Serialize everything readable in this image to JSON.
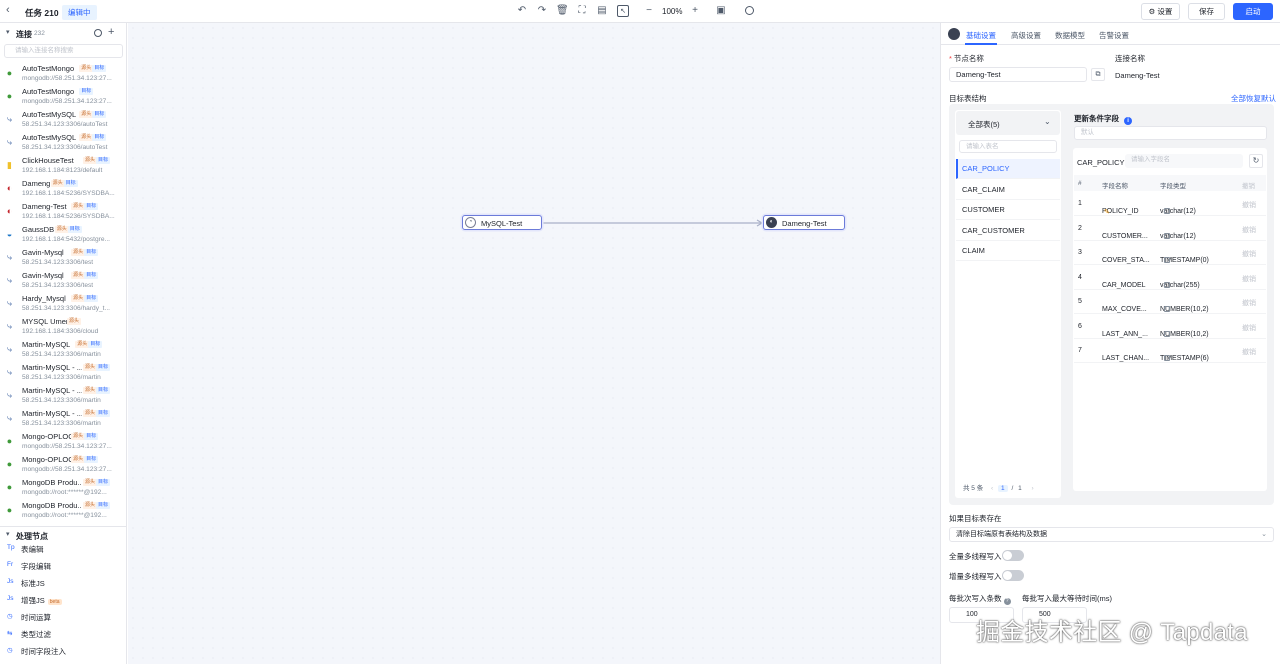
{
  "topbar": {
    "back_icon": "chevron-left-icon",
    "title": "任务 210",
    "status_badge": "编辑中",
    "zoom": "100%",
    "settings_label": "⚙ 设置",
    "save_label": "保存",
    "start_label": "启动",
    "accent": "#2c65ff"
  },
  "sidebar": {
    "connections_label": "连接",
    "connections_count": "232",
    "search_placeholder": "请输入连接名称搜索",
    "connections": [
      {
        "name": "AutoTestMongo",
        "addr": "mongodb://58.251.34.123:27...",
        "icon": "mongo",
        "src": "源头",
        "tgt": "目标"
      },
      {
        "name": "AutoTestMongo",
        "addr": "mongodb://58.251.34.123:27...",
        "icon": "mongo",
        "src": "",
        "tgt": "目标"
      },
      {
        "name": "AutoTestMySQL",
        "addr": "58.251.34.123:3306/autoTest",
        "icon": "mysql",
        "src": "源头",
        "tgt": "目标"
      },
      {
        "name": "AutoTestMySQL",
        "addr": "58.251.34.123:3306/autoTest",
        "icon": "mysql",
        "src": "源头",
        "tgt": "目标"
      },
      {
        "name": "ClickHouseTest",
        "addr": "192.168.1.184:8123/default",
        "icon": "clickhouse",
        "src": "源头",
        "tgt": "目标"
      },
      {
        "name": "Dameng",
        "addr": "192.168.1.184:5236/SYSDBA...",
        "icon": "dameng",
        "src": "源头",
        "tgt": "目标"
      },
      {
        "name": "Dameng-Test",
        "addr": "192.168.1.184:5236/SYSDBA...",
        "icon": "dameng",
        "src": "源头",
        "tgt": "目标"
      },
      {
        "name": "GaussDB",
        "addr": "192.168.1.184:5432/postgre...",
        "icon": "gauss",
        "src": "源头",
        "tgt": "目标"
      },
      {
        "name": "Gavin-Mysql",
        "addr": "58.251.34.123:3306/test",
        "icon": "mysql",
        "src": "源头",
        "tgt": "目标"
      },
      {
        "name": "Gavin-Mysql",
        "addr": "58.251.34.123:3306/test",
        "icon": "mysql",
        "src": "源头",
        "tgt": "目标"
      },
      {
        "name": "Hardy_Mysql",
        "addr": "58.251.34.123:3306/hardy_t...",
        "icon": "mysql",
        "src": "源头",
        "tgt": "目标"
      },
      {
        "name": "MYSQL Umer",
        "addr": "192.168.1.184:3306/cloud",
        "icon": "mysql",
        "src": "源头",
        "tgt": ""
      },
      {
        "name": "Martin-MySQL",
        "addr": "58.251.34.123:3306/martin",
        "icon": "mysql",
        "src": "源头",
        "tgt": "目标"
      },
      {
        "name": "Martin-MySQL - ...",
        "addr": "58.251.34.123:3306/martin",
        "icon": "mysql",
        "src": "源头",
        "tgt": "目标"
      },
      {
        "name": "Martin-MySQL - ...",
        "addr": "58.251.34.123:3306/martin",
        "icon": "mysql",
        "src": "源头",
        "tgt": "目标"
      },
      {
        "name": "Martin-MySQL - ...",
        "addr": "58.251.34.123:3306/martin",
        "icon": "mysql",
        "src": "源头",
        "tgt": "目标"
      },
      {
        "name": "Mongo-OPLOG",
        "addr": "mongodb://58.251.34.123:27...",
        "icon": "mongo",
        "src": "源头",
        "tgt": "目标"
      },
      {
        "name": "Mongo-OPLOG",
        "addr": "mongodb://58.251.34.123:27...",
        "icon": "mongo",
        "src": "源头",
        "tgt": "目标"
      },
      {
        "name": "MongoDB Produ...",
        "addr": "mongodb://root:******@192...",
        "icon": "mongo",
        "src": "源头",
        "tgt": "目标"
      },
      {
        "name": "MongoDB Produ...",
        "addr": "mongodb://root:******@192...",
        "icon": "mongo",
        "src": "源头",
        "tgt": "目标"
      }
    ],
    "processing_label": "处理节点",
    "processors": [
      {
        "icon": "Tp",
        "name": "表编辑",
        "beta": ""
      },
      {
        "icon": "Fr",
        "name": "字段编辑",
        "beta": ""
      },
      {
        "icon": "Js",
        "name": "标准JS",
        "beta": ""
      },
      {
        "icon": "Js",
        "name": "增强JS",
        "beta": "beta"
      },
      {
        "icon": "◷",
        "name": "时间运算",
        "beta": ""
      },
      {
        "icon": "⇆",
        "name": "类型过滤",
        "beta": ""
      },
      {
        "icon": "◷",
        "name": "时间字段注入",
        "beta": ""
      }
    ]
  },
  "canvas": {
    "source_node": "MySQL-Test",
    "target_node": "Dameng-Test"
  },
  "panel": {
    "tabs": [
      "基础设置",
      "高级设置",
      "数据模型",
      "告警设置"
    ],
    "node_name_label": "节点名称",
    "node_name_value": "Dameng-Test",
    "conn_name_label": "连接名称",
    "conn_name_value": "Dameng-Test",
    "target_struct_label": "目标表结构",
    "restore_all": "全部恢复默认",
    "all_tables": "全部表(5)",
    "table_search_placeholder": "请输入表名",
    "tables": [
      "CAR_POLICY",
      "CAR_CLAIM",
      "CUSTOMER",
      "CAR_CUSTOMER",
      "CLAIM"
    ],
    "update_cond_label": "更新条件字段",
    "update_cond_placeholder": "默认",
    "current_table": "CAR_POLICY",
    "field_search_placeholder": "请输入字段名",
    "col_headers": [
      "#",
      "字段名称",
      "字段类型",
      "撤销"
    ],
    "fields": [
      {
        "n": "1",
        "name": "POLICY_ID",
        "type": "varchar(12)",
        "undo": "撤销"
      },
      {
        "n": "2",
        "name": "CUSTOMER...",
        "type": "varchar(12)",
        "undo": "撤销"
      },
      {
        "n": "3",
        "name": "COVER_STA...",
        "type": "TIMESTAMP(0)",
        "undo": "撤销"
      },
      {
        "n": "4",
        "name": "CAR_MODEL",
        "type": "varchar(255)",
        "undo": "撤销"
      },
      {
        "n": "5",
        "name": "MAX_COVE...",
        "type": "NUMBER(10,2)",
        "undo": "撤销"
      },
      {
        "n": "6",
        "name": "LAST_ANN_...",
        "type": "NUMBER(10,2)",
        "undo": "撤销"
      },
      {
        "n": "7",
        "name": "LAST_CHAN...",
        "type": "TIMESTAMP(6)",
        "undo": "撤销"
      }
    ],
    "pager_total": "共 5 条",
    "pager_current": "1",
    "pager_sep": "/",
    "pager_pages": "1",
    "exists_label": "如果目标表存在",
    "exists_value": "清除目标端原有表结构及数据",
    "full_mt_label": "全量多线程写入",
    "inc_mt_label": "增量多线程写入",
    "batch_label": "每批次写入条数",
    "batch_value": "100",
    "wait_label": "每批写入最大等待时间(ms)",
    "wait_value": "500"
  },
  "watermark": "掘金技术社区 @ Tapdata"
}
